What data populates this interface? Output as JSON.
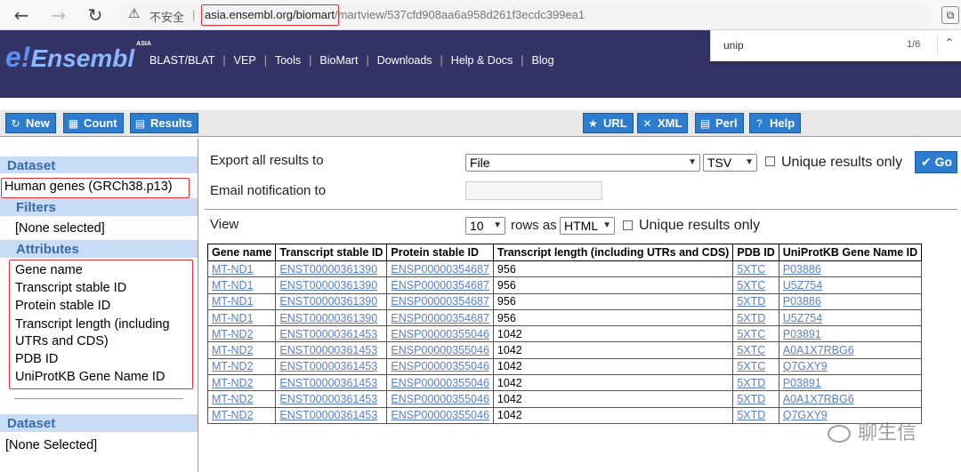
{
  "browser": {
    "insecure_label": "不安全",
    "url_host": "asia.ensembl.org/biomart",
    "url_rest": "/martview/537cfd908aa6a958d261f3ecdc399ea1",
    "find_text": "unip",
    "find_count": "1/6"
  },
  "header": {
    "logo": "Ensembl",
    "logo_suffix": "ASIA",
    "nav": [
      "BLAST/BLAT",
      "VEP",
      "Tools",
      "BioMart",
      "Downloads",
      "Help & Docs",
      "Blog"
    ]
  },
  "toolbar": {
    "new_label": "New",
    "count_label": "Count",
    "results_label": "Results",
    "url_label": "URL",
    "xml_label": "XML",
    "perl_label": "Perl",
    "help_label": "Help"
  },
  "sidebar": {
    "dataset_heading": "Dataset",
    "dataset_value": "Human genes (GRCh38.p13)",
    "filters_heading": "Filters",
    "filters_value": "[None selected]",
    "attributes_heading": "Attributes",
    "attributes": [
      "Gene name",
      "Transcript stable ID",
      "Protein stable ID",
      "Transcript length (including",
      "UTRs and CDS)",
      "PDB ID",
      "UniProtKB Gene Name ID"
    ],
    "dataset2_heading": "Dataset",
    "dataset2_value": "[None Selected]"
  },
  "main": {
    "export_label": "Export  all results to",
    "export_target": "File",
    "export_format": "TSV",
    "unique_label": "Unique results only",
    "go_label": "Go",
    "email_label": "Email notification to",
    "view_label": "View",
    "view_rows": "10",
    "rows_as_label": "rows as",
    "view_format": "HTML",
    "view_unique_label": "Unique results only"
  },
  "table": {
    "headers": [
      "Gene name",
      "Transcript stable ID",
      "Protein stable ID",
      "Transcript length (including UTRs and CDS)",
      "PDB ID",
      "UniProtKB Gene Name ID"
    ],
    "rows": [
      [
        "MT-ND1",
        "ENST00000361390",
        "ENSP00000354687",
        "956",
        "5XTC",
        "P03886"
      ],
      [
        "MT-ND1",
        "ENST00000361390",
        "ENSP00000354687",
        "956",
        "5XTC",
        "U5Z754"
      ],
      [
        "MT-ND1",
        "ENST00000361390",
        "ENSP00000354687",
        "956",
        "5XTD",
        "P03886"
      ],
      [
        "MT-ND1",
        "ENST00000361390",
        "ENSP00000354687",
        "956",
        "5XTD",
        "U5Z754"
      ],
      [
        "MT-ND2",
        "ENST00000361453",
        "ENSP00000355046",
        "1042",
        "5XTC",
        "P03891"
      ],
      [
        "MT-ND2",
        "ENST00000361453",
        "ENSP00000355046",
        "1042",
        "5XTC",
        "A0A1X7RBG6"
      ],
      [
        "MT-ND2",
        "ENST00000361453",
        "ENSP00000355046",
        "1042",
        "5XTC",
        "Q7GXY9"
      ],
      [
        "MT-ND2",
        "ENST00000361453",
        "ENSP00000355046",
        "1042",
        "5XTD",
        "P03891"
      ],
      [
        "MT-ND2",
        "ENST00000361453",
        "ENSP00000355046",
        "1042",
        "5XTD",
        "A0A1X7RBG6"
      ],
      [
        "MT-ND2",
        "ENST00000361453",
        "ENSP00000355046",
        "1042",
        "5XTD",
        "Q7GXY9"
      ]
    ]
  },
  "watermark": "聊生信"
}
